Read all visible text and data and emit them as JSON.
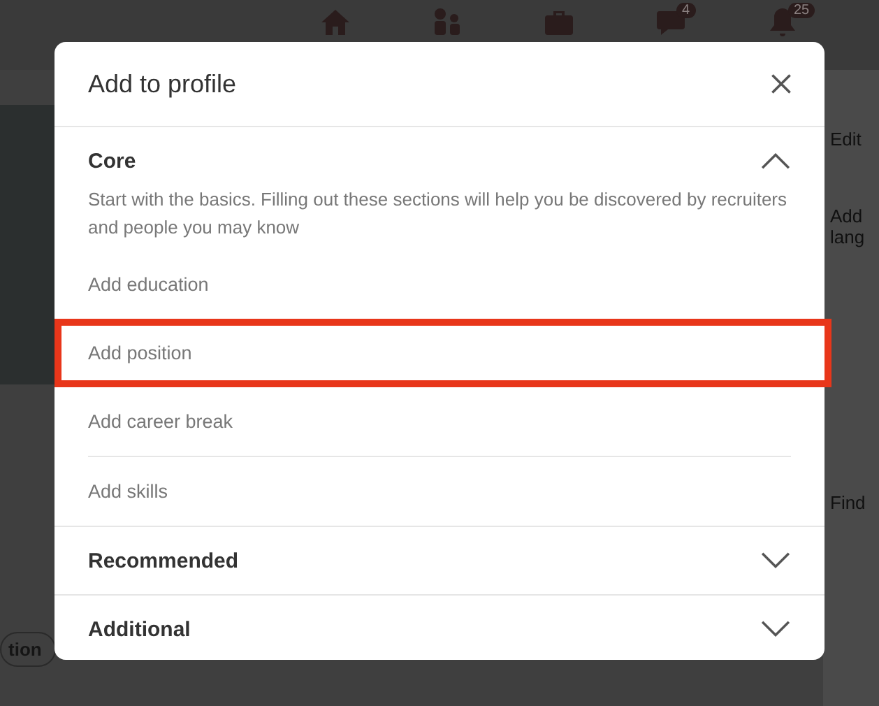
{
  "background": {
    "nav": [
      {
        "kind": "home"
      },
      {
        "kind": "people"
      },
      {
        "kind": "briefcase"
      },
      {
        "kind": "chat",
        "badge": "4"
      },
      {
        "kind": "bell",
        "badge": "25"
      }
    ],
    "side_texts": [
      "Edit",
      "Add",
      "lang",
      "Find"
    ],
    "pill": "tion"
  },
  "dialog": {
    "title": "Add to profile",
    "sections": [
      {
        "title": "Core",
        "expanded": true,
        "description": "Start with the basics. Filling out these sections will help you be discovered by recruiters and people you may know",
        "items": [
          {
            "label": "Add education",
            "highlighted": false
          },
          {
            "label": "Add position",
            "highlighted": true
          },
          {
            "label": "Add career break",
            "highlighted": false
          },
          {
            "label": "Add skills",
            "highlighted": false
          }
        ]
      },
      {
        "title": "Recommended",
        "expanded": false
      },
      {
        "title": "Additional",
        "expanded": false
      }
    ]
  }
}
